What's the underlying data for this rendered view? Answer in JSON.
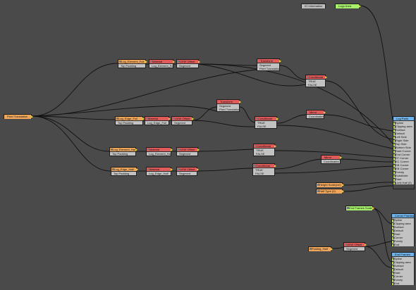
{
  "nodes": {
    "pixel_translation": {
      "title": "Pixel Translation"
    },
    "io_information": {
      "title": "IO Information"
    },
    "logo_area": {
      "title": "Logo Area"
    },
    "log_element_full": {
      "title": "Log_Element_Full",
      "rows": [
        "Top Padding"
      ]
    },
    "material_1": {
      "title": "Material",
      "rows": [
        "Log_Element_Full"
      ]
    },
    "uv_offset_1": {
      "title": "UVW Offset",
      "rows": [
        "Segment"
      ]
    },
    "transform_1": {
      "title": "Transform",
      "rows": [
        "Segment",
        "Pixel Translation"
      ]
    },
    "conditional_1": {
      "title": "Conditional",
      "rows": [
        "TRUE",
        "FALSE"
      ]
    },
    "log_edge_full": {
      "title": "Log_Edge_Full",
      "rows": [
        "Top Padding"
      ]
    },
    "material_2": {
      "title": "Material",
      "rows": [
        "Log_Edge_Full"
      ]
    },
    "uv_offset_2": {
      "title": "UVW Offset",
      "rows": [
        "Segment"
      ]
    },
    "transform_2": {
      "title": "Transform",
      "rows": [
        "Segment",
        "Pixel Translation"
      ]
    },
    "conditional_2": {
      "title": "Conditional",
      "rows": [
        "TRUE",
        "FALSE"
      ]
    },
    "mirror_1": {
      "title": "Mirror",
      "rows": [
        "Coordinates"
      ]
    },
    "log_element_half": {
      "title": "Log_Element_Half",
      "rows": [
        "Top Padding"
      ]
    },
    "material_3": {
      "title": "Material",
      "rows": [
        "Log_Element_Half"
      ]
    },
    "uv_offset_3": {
      "title": "UVW Offset",
      "rows": [
        "Segment"
      ]
    },
    "conditional_3": {
      "title": "Conditional",
      "rows": [
        "TRUE",
        "FALSE"
      ]
    },
    "log_edge_half": {
      "title": "Log_Edge_Half",
      "rows": [
        "Top Padding"
      ]
    },
    "material_4": {
      "title": "Material",
      "rows": [
        "Log_Edge_Half"
      ]
    },
    "uv_offset_4": {
      "title": "UVW Offset",
      "rows": [
        "Segment"
      ]
    },
    "conditional_4": {
      "title": "Conditional",
      "rows": [
        "TRUE",
        "FALSE"
      ]
    },
    "mirror_2": {
      "title": "Mirror",
      "rows": [
        "Coordinates"
      ]
    },
    "height_scale": {
      "title": "Height Scale(cm)"
    },
    "half_type": {
      "title": "Half Type (0)"
    },
    "log_parts": {
      "title": "Log Parts",
      "rows": [
        "Spline",
        "Clipping area",
        "Surface",
        "Default",
        "Left Side",
        "Right Side",
        "Top Side",
        "Bottom Side",
        "Start Corner",
        "End Corner",
        "ST Corner",
        "EC Corner",
        "SB Corner",
        "EB Corner",
        "Evenly",
        "Subdivide",
        "Start",
        "Limit Half (0)"
      ]
    },
    "end_frames_scale": {
      "title": "End Frames Scale"
    },
    "posting_half": {
      "title": "Posting_Half"
    },
    "uv_offset_5": {
      "title": "UVW Offset",
      "rows": [
        "Segment"
      ]
    },
    "corner_frames": {
      "title": "Corner Frames",
      "rows": [
        "Spline",
        "Clipping area",
        "Surface",
        "Default",
        "Start",
        "Corner",
        "Evenly",
        "End"
      ]
    },
    "end_frames": {
      "title": "End Frames",
      "rows": [
        "Spline",
        "Clipping area",
        "Surface",
        "Default",
        "Start",
        "Corner",
        "Evenly",
        "End"
      ]
    }
  }
}
